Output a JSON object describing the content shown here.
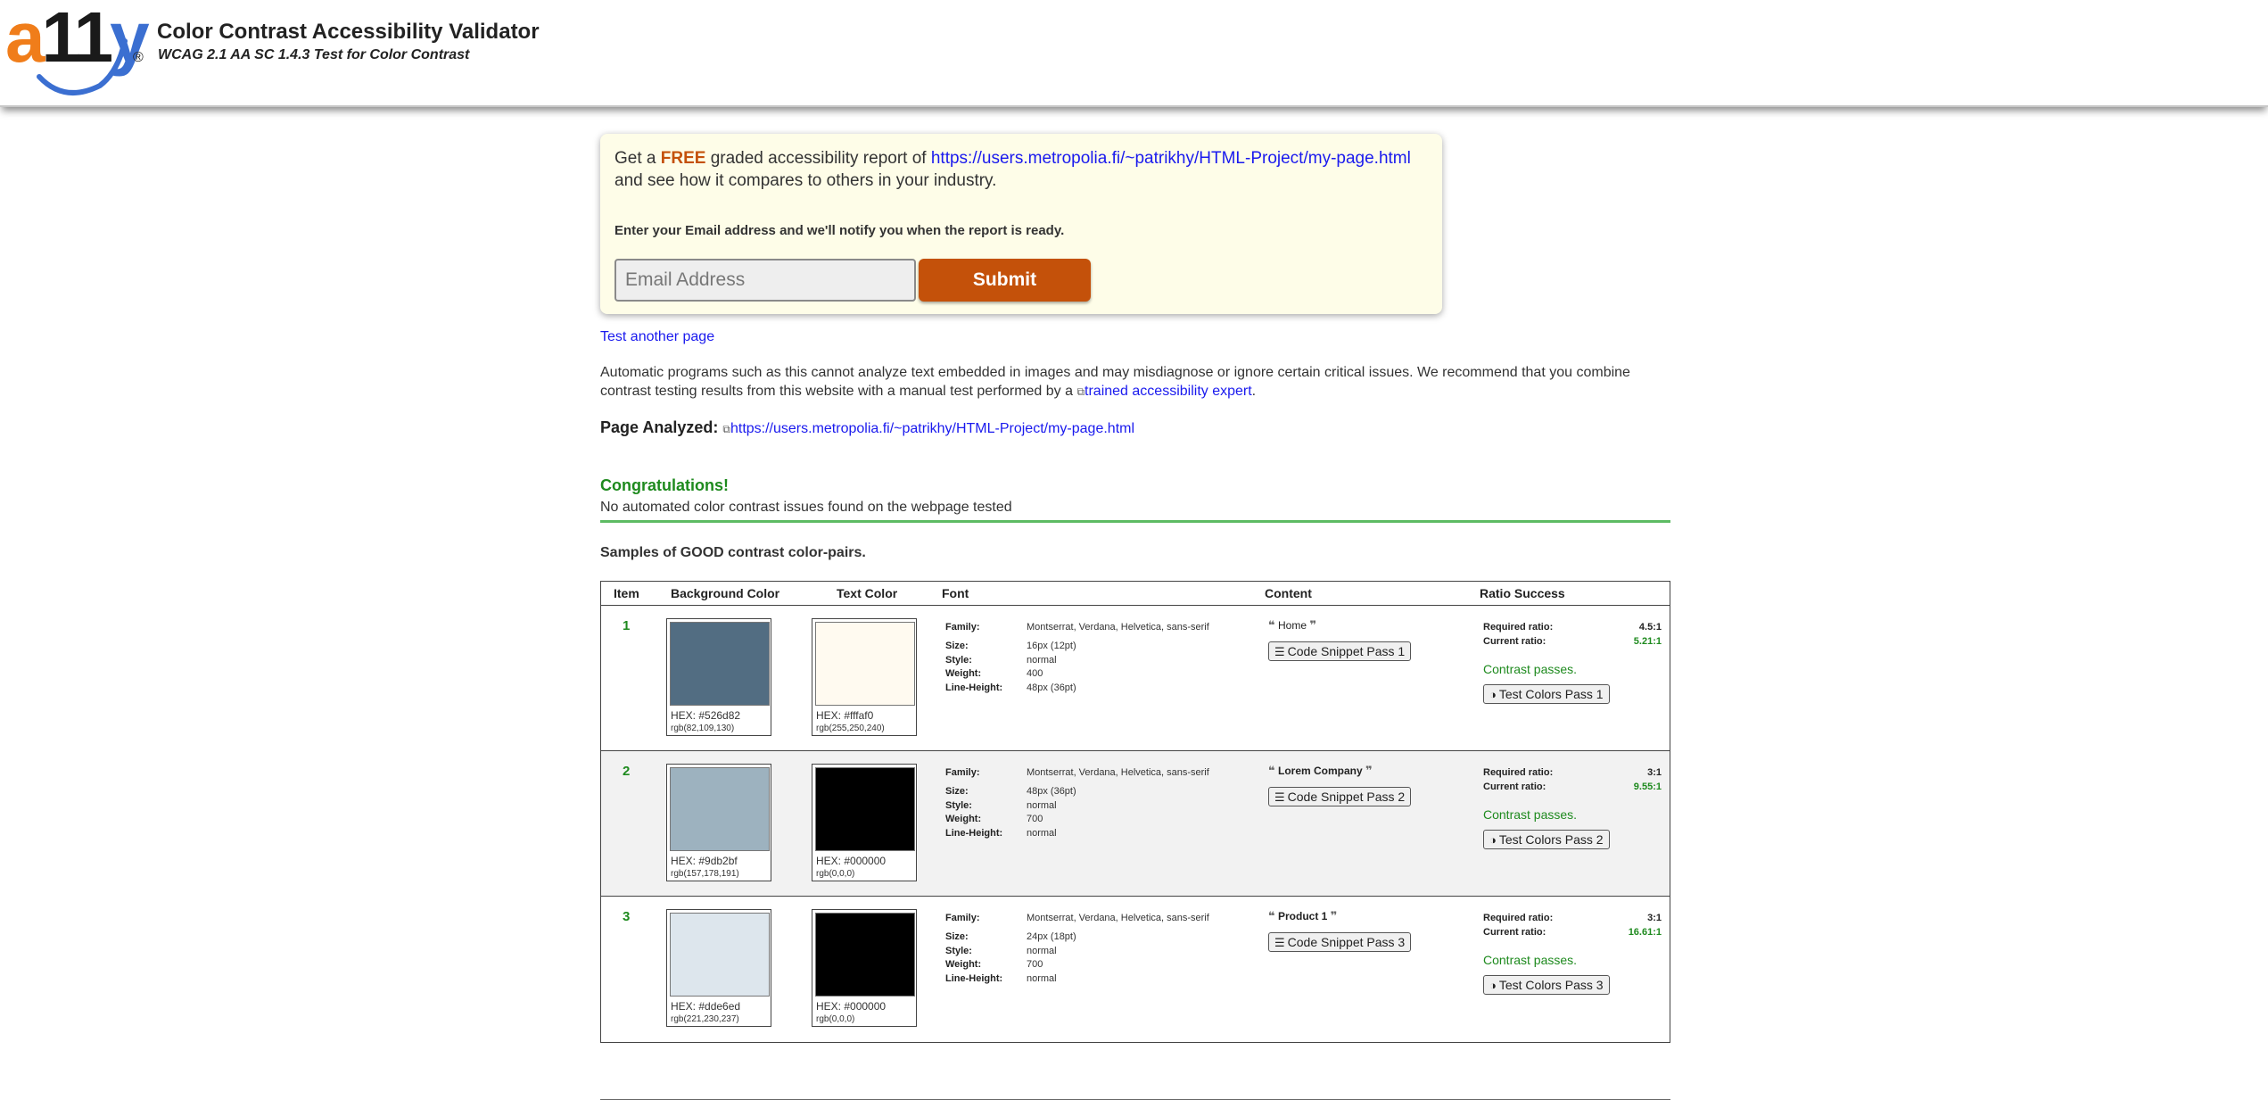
{
  "header": {
    "logo_text_a": "a",
    "logo_text_11": "11",
    "logo_text_y": "y",
    "logo_reg": "®",
    "title": "Color Contrast Accessibility Validator",
    "subtitle": "WCAG 2.1 AA SC 1.4.3 Test for Color Contrast"
  },
  "promo": {
    "prefix": "Get a ",
    "free": "FREE",
    "middle": " graded accessibility report of ",
    "url": "https://users.metropolia.fi/~patrikhy/HTML-Project/my-page.html",
    "line2": "and see how it compares to others in your industry.",
    "notify": "Enter your Email address and we'll notify you when the report is ready.",
    "email_placeholder": "Email Address",
    "submit_label": "Submit"
  },
  "test_another_label": "Test another page",
  "disclaimer": {
    "text": "Automatic programs such as this cannot analyze text embedded in images and may misdiagnose or ignore certain critical issues. We recommend that you combine contrast testing results from this website with a manual test performed by a ",
    "link": "trained accessibility expert",
    "end": "."
  },
  "page_analyzed": {
    "label": "Page Analyzed:",
    "url": "https://users.metropolia.fi/~patrikhy/HTML-Project/my-page.html"
  },
  "results": {
    "congrats": "Congratulations!",
    "no_issues": "No automated color contrast issues found on the webpage tested",
    "samples_heading": "Samples of GOOD contrast color-pairs."
  },
  "table": {
    "headers": {
      "item": "Item",
      "background": "Background Color",
      "text": "Text Color",
      "font": "Font",
      "content": "Content",
      "ratio": "Ratio Success"
    },
    "font_labels": {
      "family": "Family:",
      "size": "Size:",
      "style": "Style:",
      "weight": "Weight:",
      "line_height": "Line-Height:"
    },
    "ratio_labels": {
      "required": "Required ratio:",
      "current": "Current ratio:",
      "passes": "Contrast passes."
    },
    "rows": [
      {
        "item": "1",
        "bg_hex_label": "HEX: #526d82",
        "bg_rgb_label": "rgb(82,109,130)",
        "bg_color": "#526d82",
        "fg_hex_label": "HEX: #fffaf0",
        "fg_rgb_label": "rgb(255,250,240)",
        "fg_color": "#fffaf0",
        "family": "Montserrat, Verdana, Helvetica, sans-serif",
        "size": "16px (12pt)",
        "style": "normal",
        "weight": "400",
        "line_height": "48px (36pt)",
        "content": "Home",
        "content_bold": false,
        "snippet_label": "Code Snippet Pass 1",
        "required": "4.5:1",
        "current": "5.21:1",
        "test_label": "Test Colors Pass 1"
      },
      {
        "item": "2",
        "bg_hex_label": "HEX: #9db2bf",
        "bg_rgb_label": "rgb(157,178,191)",
        "bg_color": "#9db2bf",
        "fg_hex_label": "HEX: #000000",
        "fg_rgb_label": "rgb(0,0,0)",
        "fg_color": "#000000",
        "family": "Montserrat, Verdana, Helvetica, sans-serif",
        "size": "48px (36pt)",
        "style": "normal",
        "weight": "700",
        "line_height": "normal",
        "content": "Lorem Company",
        "content_bold": true,
        "snippet_label": "Code Snippet Pass 2",
        "required": "3:1",
        "current": "9.55:1",
        "test_label": "Test Colors Pass 2"
      },
      {
        "item": "3",
        "bg_hex_label": "HEX: #dde6ed",
        "bg_rgb_label": "rgb(221,230,237)",
        "bg_color": "#dde6ed",
        "fg_hex_label": "HEX: #000000",
        "fg_rgb_label": "rgb(0,0,0)",
        "fg_color": "#000000",
        "family": "Montserrat, Verdana, Helvetica, sans-serif",
        "size": "24px (18pt)",
        "style": "normal",
        "weight": "700",
        "line_height": "normal",
        "content": "Product 1",
        "content_bold": true,
        "snippet_label": "Code Snippet Pass 3",
        "required": "3:1",
        "current": "16.61:1",
        "test_label": "Test Colors Pass 3"
      }
    ]
  },
  "colors": {
    "brand_orange": "#c4510a",
    "link_blue": "#1a1aee",
    "success_green": "#1e8a1e",
    "promo_bg": "#fefde8"
  },
  "icons": {
    "quote_open": "quote-open-icon",
    "quote_close": "quote-close-icon",
    "code": "code-icon",
    "contrast": "contrast-icon",
    "external": "external-link-icon"
  }
}
